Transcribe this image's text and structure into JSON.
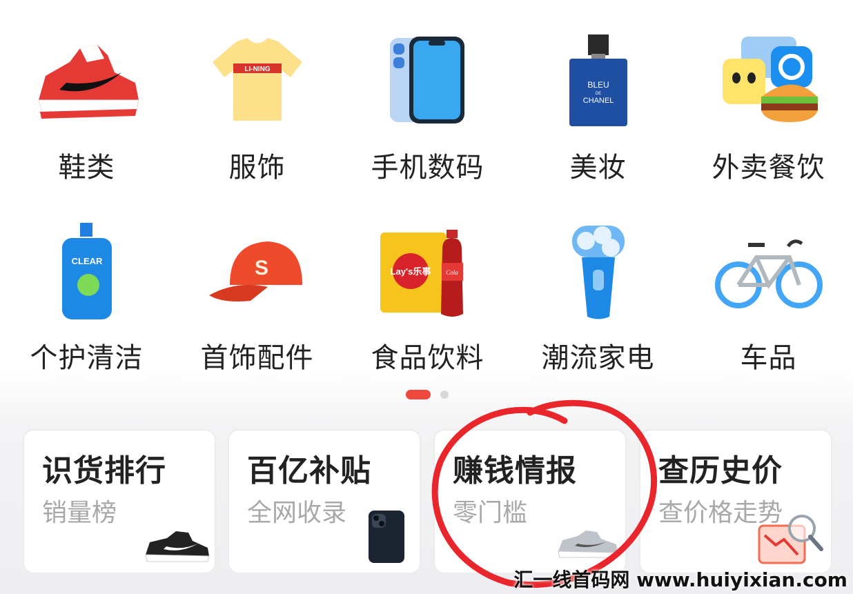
{
  "categories": [
    {
      "label": "鞋类",
      "icon": "sneaker-icon"
    },
    {
      "label": "服饰",
      "icon": "tshirt-icon"
    },
    {
      "label": "手机数码",
      "icon": "phone-icon"
    },
    {
      "label": "美妆",
      "icon": "perfume-icon"
    },
    {
      "label": "外卖餐饮",
      "icon": "food-delivery-icon"
    },
    {
      "label": "个护清洁",
      "icon": "shampoo-icon"
    },
    {
      "label": "首饰配件",
      "icon": "cap-icon"
    },
    {
      "label": "食品饮料",
      "icon": "snacks-icon"
    },
    {
      "label": "潮流家电",
      "icon": "shaver-icon"
    },
    {
      "label": "车品",
      "icon": "bicycle-icon"
    }
  ],
  "icon_text": {
    "tshirt_brand": "LI-NING",
    "perfume_line1": "BLEU",
    "perfume_line2": "DE",
    "perfume_line3": "CHANEL",
    "shampoo_brand": "CLEAR",
    "cap_letter": "S",
    "chips_brand": "Lay's乐事",
    "cola_brand": "Cola"
  },
  "pager": {
    "pages": 2,
    "active": 1
  },
  "cards": [
    {
      "title": "识货排行",
      "subtitle": "销量榜",
      "image": "sneaker-icon"
    },
    {
      "title": "百亿补贴",
      "subtitle": "全网收录",
      "image": "phone-icon"
    },
    {
      "title": "赚钱情报",
      "subtitle": "零门槛",
      "image": "sneaker-icon"
    },
    {
      "title": "查历史价",
      "subtitle": "查价格走势",
      "image": "price-chart-icon"
    }
  ],
  "watermark": "汇一线首码网 www.huiyixian.com",
  "colors": {
    "accent": "#f0473e",
    "circle": "#e8262b"
  }
}
